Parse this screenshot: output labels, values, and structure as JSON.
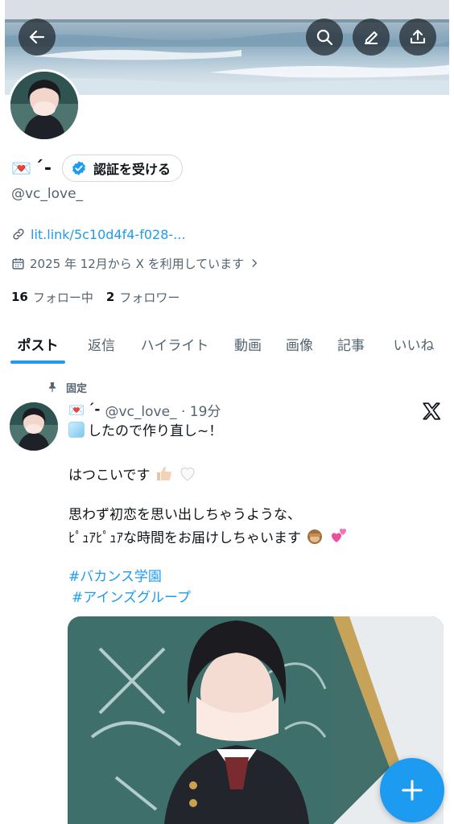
{
  "profile": {
    "name_emoji": "💌",
    "name": "´-",
    "verify_label": "認証を受ける",
    "handle": "@vc_love_",
    "link": "lit.link/5c10d4f4-f028-...",
    "joined": "2025 年 12月から X を利用しています",
    "following_count": "16",
    "following_label": "フォロー中",
    "followers_count": "2",
    "followers_label": "フォロワー"
  },
  "tabs": [
    {
      "label": "ポスト",
      "active": true
    },
    {
      "label": "返信"
    },
    {
      "label": "ハイライト"
    },
    {
      "label": "動画"
    },
    {
      "label": "画像"
    },
    {
      "label": "記事"
    },
    {
      "label": "いいね"
    }
  ],
  "post": {
    "pinned_label": "固定",
    "author_emoji": "💌",
    "author_name": "´-",
    "handle_time": "@vc_love_ · 19分",
    "line1": "したので作り直し~！",
    "line2": "はつこいです",
    "line3": "思わず初恋を思い出しちゃうような、",
    "line4": "ﾋﾟｭｱﾋﾟｭｱな時間をお届けしちゃいます",
    "hashtag1": "#バカンス学園",
    "hashtag2": "#アインズグループ"
  },
  "colors": {
    "accent": "#1d9bf0",
    "text": "#0f1419",
    "muted": "#536471"
  },
  "icons": [
    "back-arrow-icon",
    "search-icon",
    "edit-icon",
    "share-icon",
    "verified-check-icon",
    "link-icon",
    "calendar-icon",
    "chevron-right-icon",
    "pin-icon",
    "x-logo-icon",
    "plus-icon"
  ]
}
